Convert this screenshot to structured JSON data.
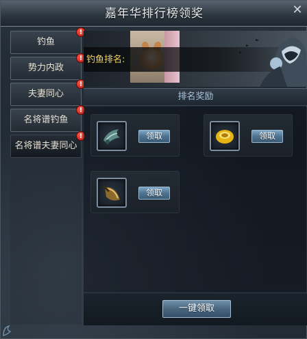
{
  "window": {
    "title": "嘉年华排行榜领奖",
    "close_glyph": "✕"
  },
  "sidebar": {
    "items": [
      {
        "label": "钓鱼",
        "badge": "!"
      },
      {
        "label": "势力内政",
        "badge": "!"
      },
      {
        "label": "夫妻同心",
        "badge": "!"
      },
      {
        "label": "名将谱钓鱼",
        "badge": "!"
      },
      {
        "label": "名将谱夫妻同心",
        "badge": "!"
      }
    ]
  },
  "banner": {
    "rank_label": "钓鱼排名:"
  },
  "rewards": {
    "header": "排名奖励",
    "items": [
      {
        "icon": "jade-accessory-icon",
        "button": "领取"
      },
      {
        "icon": "gold-ring-icon",
        "button": "领取"
      },
      {
        "icon": "bronze-horn-icon",
        "button": "领取"
      }
    ]
  },
  "footer": {
    "claim_all": "一键领取"
  },
  "colors": {
    "accent_yellow": "#f1d35b",
    "badge_red": "#d8241a",
    "button_blue": "#4f7390"
  }
}
